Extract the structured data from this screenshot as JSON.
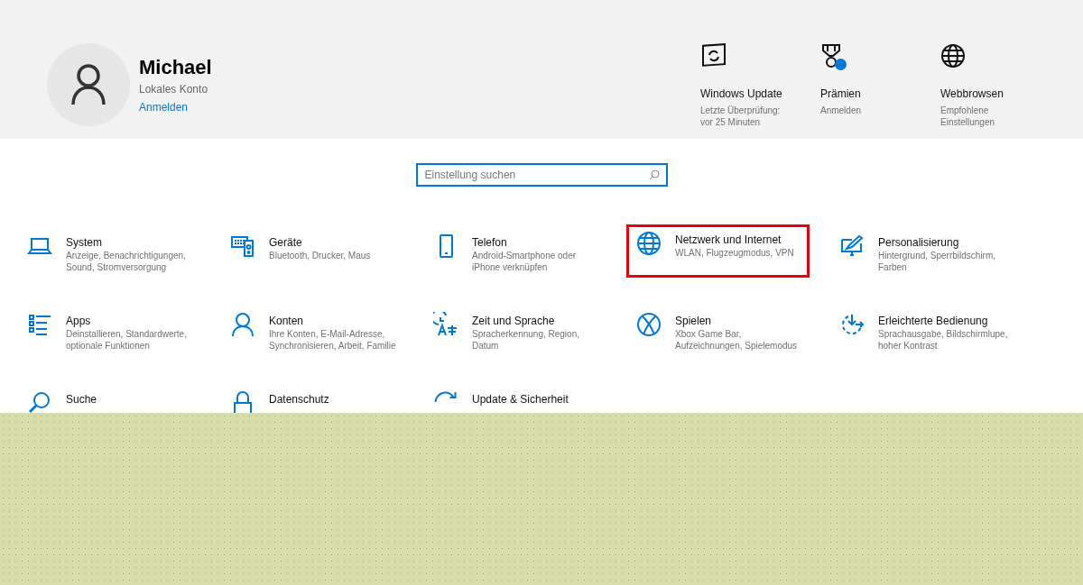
{
  "account": {
    "name": "Michael",
    "type": "Lokales Konto",
    "link": "Anmelden"
  },
  "shortcuts": [
    {
      "title": "Windows Update",
      "lines": [
        "Letzte Überprüfung:",
        "vor 25 Minuten"
      ],
      "badge": false
    },
    {
      "title": "Prämien",
      "lines": [
        "Anmelden"
      ],
      "badge": true
    },
    {
      "title": "Webbrowsen",
      "lines": [
        "Empfohlene",
        "Einstellungen"
      ],
      "badge": false
    }
  ],
  "search": {
    "placeholder": "Einstellung suchen"
  },
  "categories": [
    {
      "title": "System",
      "lines": [
        "Anzeige, Benachrichtigungen,",
        "Sound, Stromversorgung"
      ],
      "highlighted": false
    },
    {
      "title": "Geräte",
      "lines": [
        "Bluetooth, Drucker, Maus"
      ],
      "highlighted": false
    },
    {
      "title": "Telefon",
      "lines": [
        "Android-Smartphone oder",
        "iPhone verknüpfen"
      ],
      "highlighted": false
    },
    {
      "title": "Netzwerk und Internet",
      "lines": [
        "WLAN, Flugzeugmodus, VPN"
      ],
      "highlighted": true
    },
    {
      "title": "Personalisierung",
      "lines": [
        "Hintergrund, Sperrbildschirm,",
        "Farben"
      ],
      "highlighted": false
    },
    {
      "title": "Apps",
      "lines": [
        "Deinstallieren, Standardwerte,",
        "optionale Funktionen"
      ],
      "highlighted": false
    },
    {
      "title": "Konten",
      "lines": [
        "Ihre Konten, E-Mail-Adresse,",
        "Synchronisieren, Arbeit, Familie"
      ],
      "highlighted": false
    },
    {
      "title": "Zeit und Sprache",
      "lines": [
        "Spracherkennung, Region,",
        "Datum"
      ],
      "highlighted": false
    },
    {
      "title": "Spielen",
      "lines": [
        "Xbox Game Bar,",
        "Aufzeichnungen, Spielemodus"
      ],
      "highlighted": false
    },
    {
      "title": "Erleichterte Bedienung",
      "lines": [
        "Sprachausgabe, Bildschirmlupe,",
        "hoher Kontrast"
      ],
      "highlighted": false
    },
    {
      "title": "Suche",
      "highlighted": false
    },
    {
      "title": "Datenschutz",
      "highlighted": false
    },
    {
      "title": "Update & Sicherheit",
      "highlighted": false
    }
  ]
}
